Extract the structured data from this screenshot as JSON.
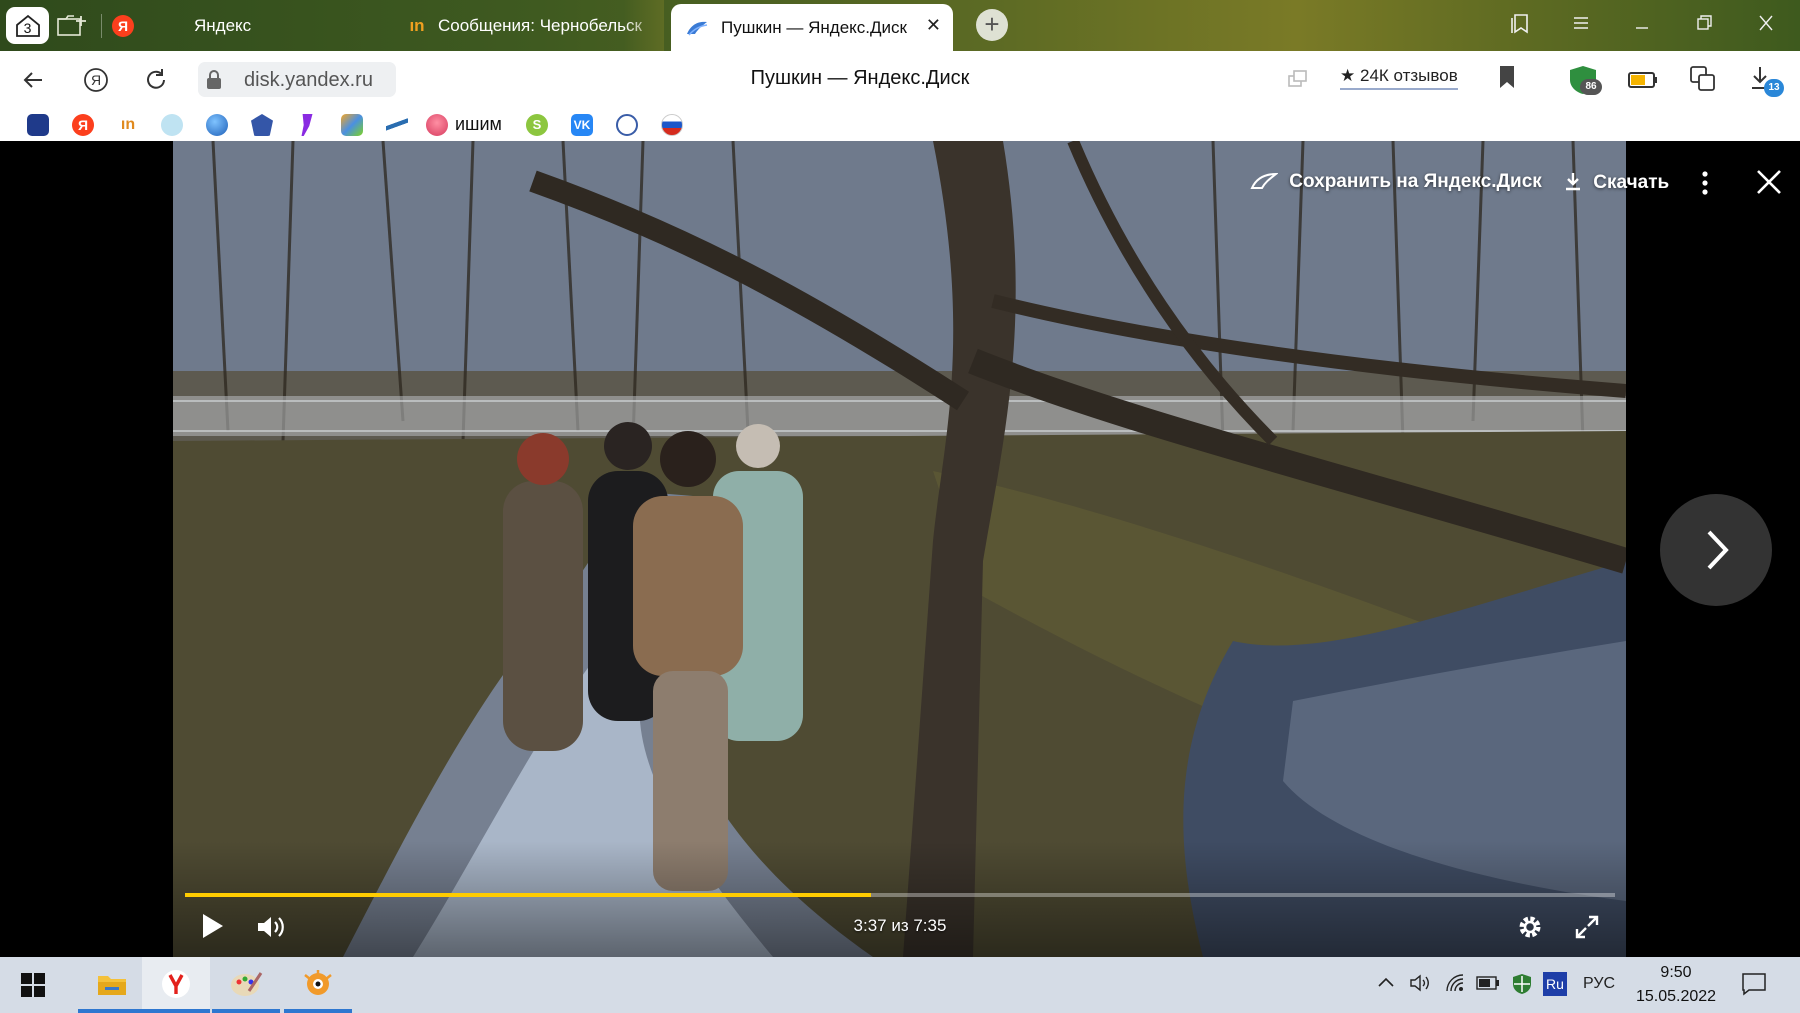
{
  "browser": {
    "tab_count": "3",
    "tabs": [
      {
        "label": "Яндекс"
      },
      {
        "label": "Сообщения: Чернобельск"
      },
      {
        "label": "Пушкин — Яндекс.Диск"
      }
    ],
    "address": "disk.yandex.ru",
    "page_title": "Пушкин — Яндекс.Диск",
    "reviews_label": "24К отзывов",
    "extension_badge": "86",
    "downloads_badge": "13",
    "bookmark_label": "ишим"
  },
  "viewer": {
    "save_label": "Сохранить на Яндекс.Диск",
    "download_label": "Скачать",
    "time_label": "3:37 из 7:35",
    "progress_fraction": 0.48
  },
  "taskbar": {
    "tray_language": "РУС",
    "ime_label": "Ru",
    "clock_time": "9:50",
    "clock_date": "15.05.2022"
  },
  "colors": {
    "progress": "#ffcc00",
    "accent": "#2e77d0",
    "yandex_red": "#fc3f1d"
  }
}
